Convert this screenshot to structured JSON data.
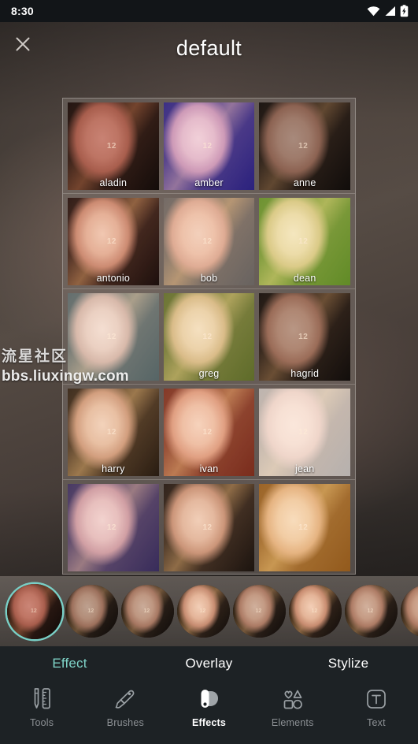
{
  "status_bar": {
    "time": "8:30",
    "icons": [
      "wifi-icon",
      "cellular-signal-icon",
      "battery-charging-icon"
    ]
  },
  "header": {
    "title": "default",
    "close_icon": "close-icon"
  },
  "watermark": {
    "community": "流星社区",
    "url": "bbs.liuxingw.com"
  },
  "filter_grid": {
    "thumbnail_badge": "12",
    "rows": [
      [
        {
          "name": "aladin",
          "tint": "rgba(150,22,18,0.40)",
          "blend": "multiply"
        },
        {
          "name": "amber",
          "tint": "rgba(40,30,225,0.52)",
          "blend": "screen"
        },
        {
          "name": "anne",
          "tint": "rgba(30,10,8,0.34)",
          "blend": "multiply"
        }
      ],
      [
        {
          "name": "antonio",
          "tint": "rgba(190,60,60,0.26)",
          "blend": "soft-light"
        },
        {
          "name": "bob",
          "tint": "rgba(220,220,225,0.40)",
          "blend": "luminosity"
        },
        {
          "name": "dean",
          "tint": "rgba(130,210,40,0.62)",
          "blend": "screen"
        }
      ],
      [
        {
          "name": "",
          "tint": "rgba(150,195,200,0.46)",
          "blend": "screen"
        },
        {
          "name": "greg",
          "tint": "rgba(170,210,60,0.46)",
          "blend": "screen"
        },
        {
          "name": "hagrid",
          "tint": "rgba(60,30,15,0.30)",
          "blend": "multiply"
        }
      ],
      [
        {
          "name": "harry",
          "tint": "rgba(235,200,150,0.42)",
          "blend": "soft-light"
        },
        {
          "name": "ivan",
          "tint": "rgba(235,60,30,0.46)",
          "blend": "screen"
        },
        {
          "name": "jean",
          "tint": "rgba(245,245,245,0.70)",
          "blend": "luminosity"
        }
      ],
      [
        {
          "name": "",
          "tint": "rgba(90,70,200,0.40)",
          "blend": "screen"
        },
        {
          "name": "",
          "tint": "rgba(180,150,120,0.22)",
          "blend": "soft-light"
        },
        {
          "name": "",
          "tint": "rgba(245,140,25,0.55)",
          "blend": "screen"
        }
      ]
    ]
  },
  "preset_strip": {
    "badge": "12",
    "presets": [
      {
        "selected": true,
        "tint": "rgba(150,22,18,0.40)",
        "blend": "multiply"
      },
      {
        "selected": false,
        "tint": "rgba(40,22,16,0.26)",
        "blend": "multiply"
      },
      {
        "selected": false,
        "tint": "rgba(60,40,30,0.22)",
        "blend": "multiply"
      },
      {
        "selected": false,
        "tint": "rgba(90,60,40,0.18)",
        "blend": "soft-light"
      },
      {
        "selected": false,
        "tint": "rgba(70,45,30,0.20)",
        "blend": "multiply"
      },
      {
        "selected": false,
        "tint": "rgba(110,75,45,0.22)",
        "blend": "soft-light"
      },
      {
        "selected": false,
        "tint": "rgba(80,52,34,0.20)",
        "blend": "multiply"
      },
      {
        "selected": false,
        "tint": "rgba(95,62,40,0.20)",
        "blend": "multiply"
      }
    ]
  },
  "sub_tabs": [
    {
      "label": "Effect",
      "active": true
    },
    {
      "label": "Overlay",
      "active": false
    },
    {
      "label": "Stylize",
      "active": false
    }
  ],
  "nav_bar": [
    {
      "label": "Tools",
      "icon": "pencil-ruler-icon",
      "active": false
    },
    {
      "label": "Brushes",
      "icon": "brush-icon",
      "active": false
    },
    {
      "label": "Effects",
      "icon": "effects-icon",
      "active": true
    },
    {
      "label": "Elements",
      "icon": "shapes-icon",
      "active": false
    },
    {
      "label": "Text",
      "icon": "text-box-icon",
      "active": false
    }
  ],
  "colors": {
    "accent": "#7fd4c8",
    "panel": "#1d2225",
    "status_bar": "#121518",
    "inactive_label": "#8c9094"
  }
}
